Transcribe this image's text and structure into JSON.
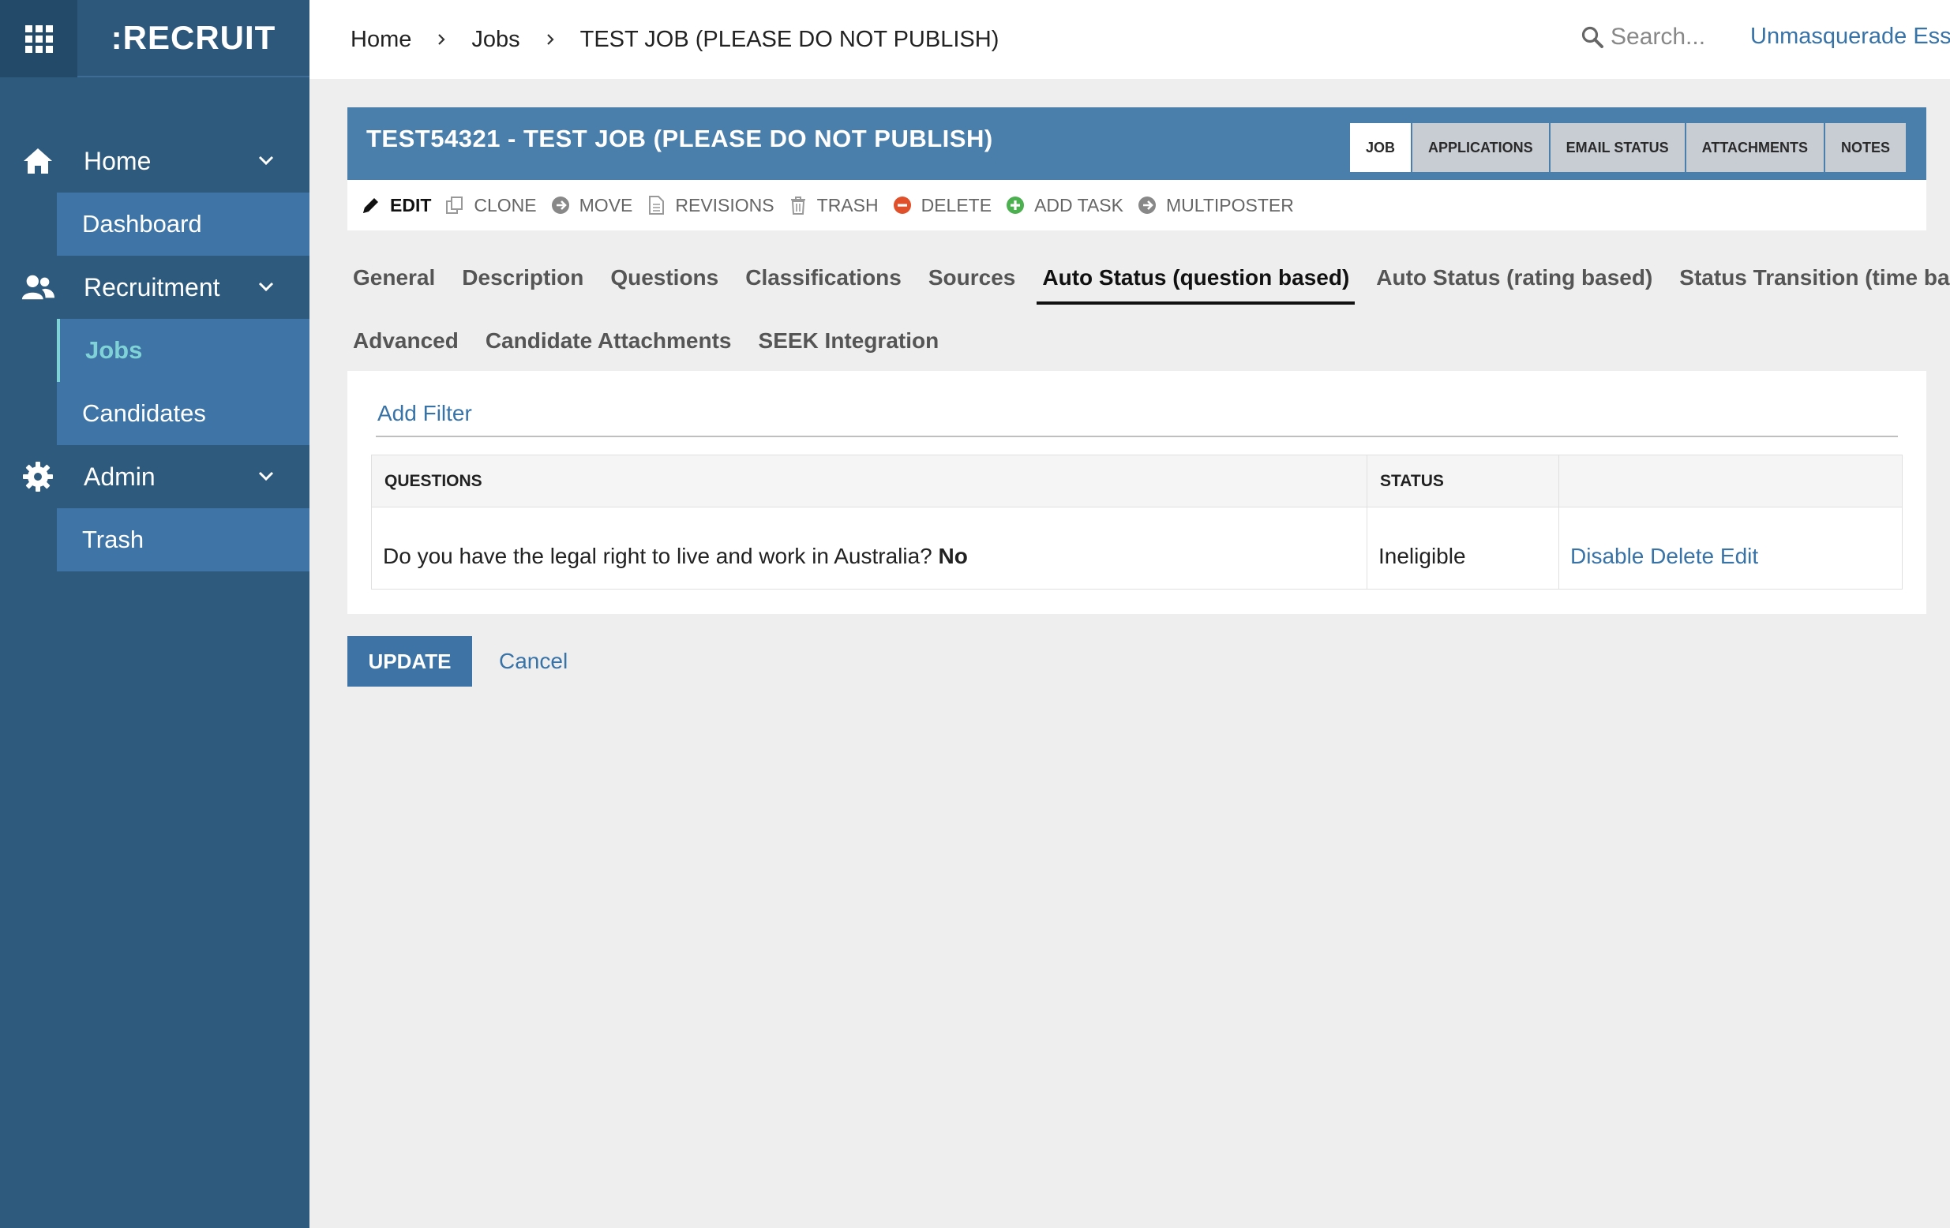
{
  "app": {
    "logo": ":RECRUIT"
  },
  "sidebar": {
    "groups": [
      {
        "label": "Home",
        "items": [
          {
            "label": "Dashboard"
          }
        ]
      },
      {
        "label": "Recruitment",
        "items": [
          {
            "label": "Jobs"
          },
          {
            "label": "Candidates"
          }
        ]
      },
      {
        "label": "Admin",
        "items": [
          {
            "label": "Trash"
          }
        ]
      }
    ]
  },
  "header": {
    "breadcrumb": [
      "Home",
      "Jobs",
      "TEST JOB (PLEASE DO NOT PUBLISH)"
    ],
    "search_placeholder": "Search...",
    "user_link": "Unmasquerade Esser"
  },
  "job": {
    "title": "TEST54321 - TEST JOB (PLEASE DO NOT PUBLISH)",
    "tabs": [
      "JOB",
      "APPLICATIONS",
      "EMAIL STATUS",
      "ATTACHMENTS",
      "NOTES"
    ],
    "active_tab": "JOB"
  },
  "actions": [
    "EDIT",
    "CLONE",
    "MOVE",
    "REVISIONS",
    "TRASH",
    "DELETE",
    "ADD TASK",
    "MULTIPOSTER"
  ],
  "section_tabs": {
    "row1": [
      "General",
      "Description",
      "Questions",
      "Classifications",
      "Sources",
      "Auto Status (question based)",
      "Auto Status (rating based)",
      "Status Transition (time based)"
    ],
    "row2": [
      "Advanced",
      "Candidate Attachments",
      "SEEK Integration"
    ],
    "active": "Auto Status (question based)"
  },
  "panel": {
    "add_filter": "Add Filter",
    "columns": [
      "QUESTIONS",
      "STATUS",
      ""
    ],
    "rows": [
      {
        "question": "Do you have the legal right to live and work in Australia?",
        "answer": "No",
        "status": "Ineligible",
        "links": [
          "Disable",
          "Delete",
          "Edit"
        ]
      }
    ]
  },
  "buttons": {
    "update": "UPDATE",
    "cancel": "Cancel"
  },
  "colors": {
    "sidebar": "#2e5a7e",
    "sidebar_sub": "#3f75a6",
    "header_bar": "#4a7eab",
    "link": "#3873a8",
    "active_nav": "#7fd3d6",
    "delete_icon": "#e0502a",
    "add_icon": "#4caf50"
  }
}
